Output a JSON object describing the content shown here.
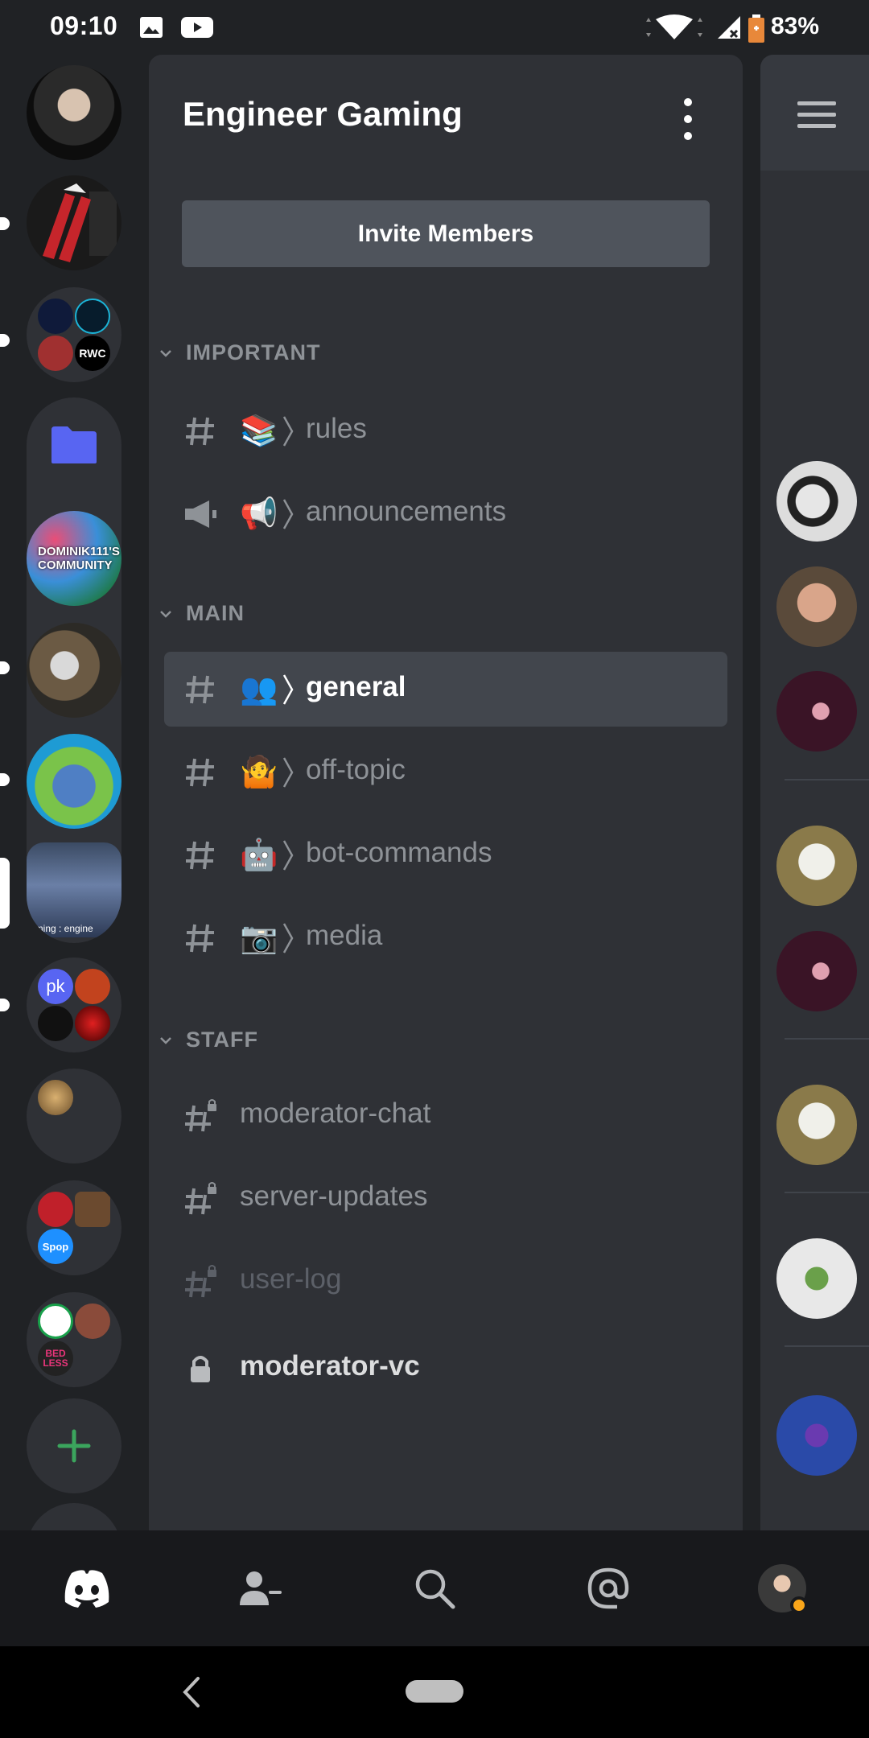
{
  "status_bar": {
    "time": "09:10",
    "battery": "83%",
    "icons": [
      "image-icon",
      "youtube-icon",
      "wifi-icon",
      "signal-icon",
      "battery-icon"
    ]
  },
  "server": {
    "name": "Engineer Gaming",
    "invite_label": "Invite Members"
  },
  "server_rail": {
    "folder_labels": [
      "pk",
      "Spop",
      "RWC",
      "BED LESS"
    ],
    "community_text": "DOMINIK111'S COMMUNITY",
    "active_thumb_text": "aming : engine"
  },
  "categories": [
    {
      "name": "IMPORTANT",
      "channels": [
        {
          "name": "rules",
          "emoji": "📚",
          "type": "text"
        },
        {
          "name": "announcements",
          "emoji": "📢",
          "type": "announcement"
        }
      ]
    },
    {
      "name": "MAIN",
      "channels": [
        {
          "name": "general",
          "emoji": "👥",
          "type": "text",
          "selected": true
        },
        {
          "name": "off-topic",
          "emoji": "🤷",
          "type": "text"
        },
        {
          "name": "bot-commands",
          "emoji": "🤖",
          "type": "text"
        },
        {
          "name": "media",
          "emoji": "📷",
          "type": "text"
        }
      ]
    },
    {
      "name": "STAFF",
      "channels": [
        {
          "name": "moderator-chat",
          "type": "locked-text"
        },
        {
          "name": "server-updates",
          "type": "locked-text"
        },
        {
          "name": "user-log",
          "type": "locked-text",
          "muted": true
        },
        {
          "name": "moderator-vc",
          "type": "locked-voice"
        }
      ]
    }
  ],
  "bottom_nav": [
    "discord-home-icon",
    "friends-icon",
    "search-icon",
    "mentions-icon",
    "profile-avatar"
  ],
  "colors": {
    "background": "#202225",
    "panel": "#2f3136",
    "selected": "#42464d",
    "muted_text": "#8e9297",
    "add_server": "#3ba55d",
    "folder": "#5865f2"
  }
}
